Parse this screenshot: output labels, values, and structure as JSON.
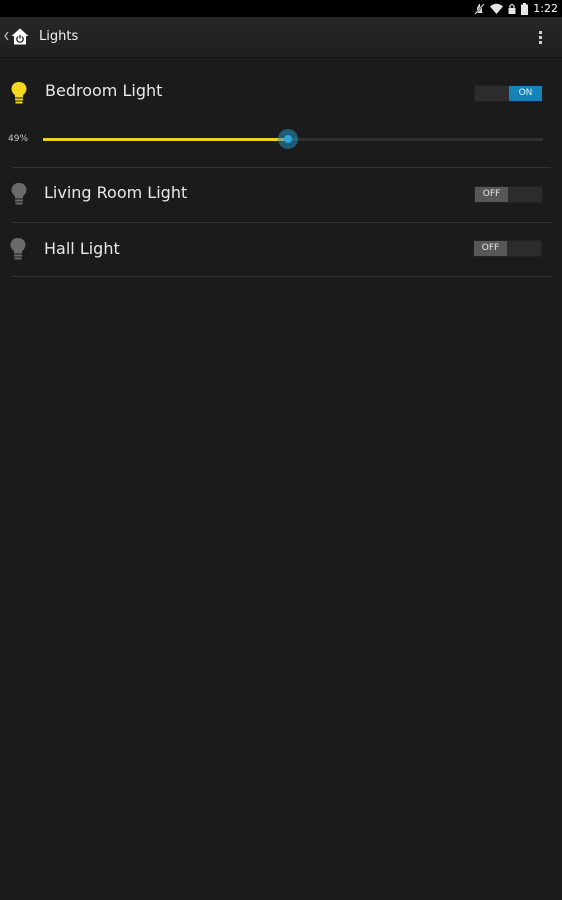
{
  "status_bar": {
    "time": "1:22",
    "icons": [
      "notification-muted-icon",
      "wifi-icon",
      "lock-icon",
      "battery-icon"
    ]
  },
  "action_bar": {
    "title": "Lights",
    "up_icon": "chevron-left-icon",
    "app_icon": "home-power-icon",
    "overflow_icon": "overflow-menu-icon"
  },
  "lights": [
    {
      "name": "Bedroom Light",
      "state": "ON",
      "on": true,
      "brightness_label": "49%",
      "brightness": 0.49
    },
    {
      "name": "Living Room Light",
      "state": "OFF",
      "on": false
    },
    {
      "name": "Hall Light",
      "state": "OFF",
      "on": false
    }
  ],
  "colors": {
    "background": "#1b1b1b",
    "bulb_on": "#f2d81e",
    "bulb_off": "#6a6a6a",
    "toggle_on": "#1583b7",
    "toggle_off": "#575757",
    "slider_fill": "#e9cf1e",
    "slider_thumb": "#2aa7df"
  }
}
